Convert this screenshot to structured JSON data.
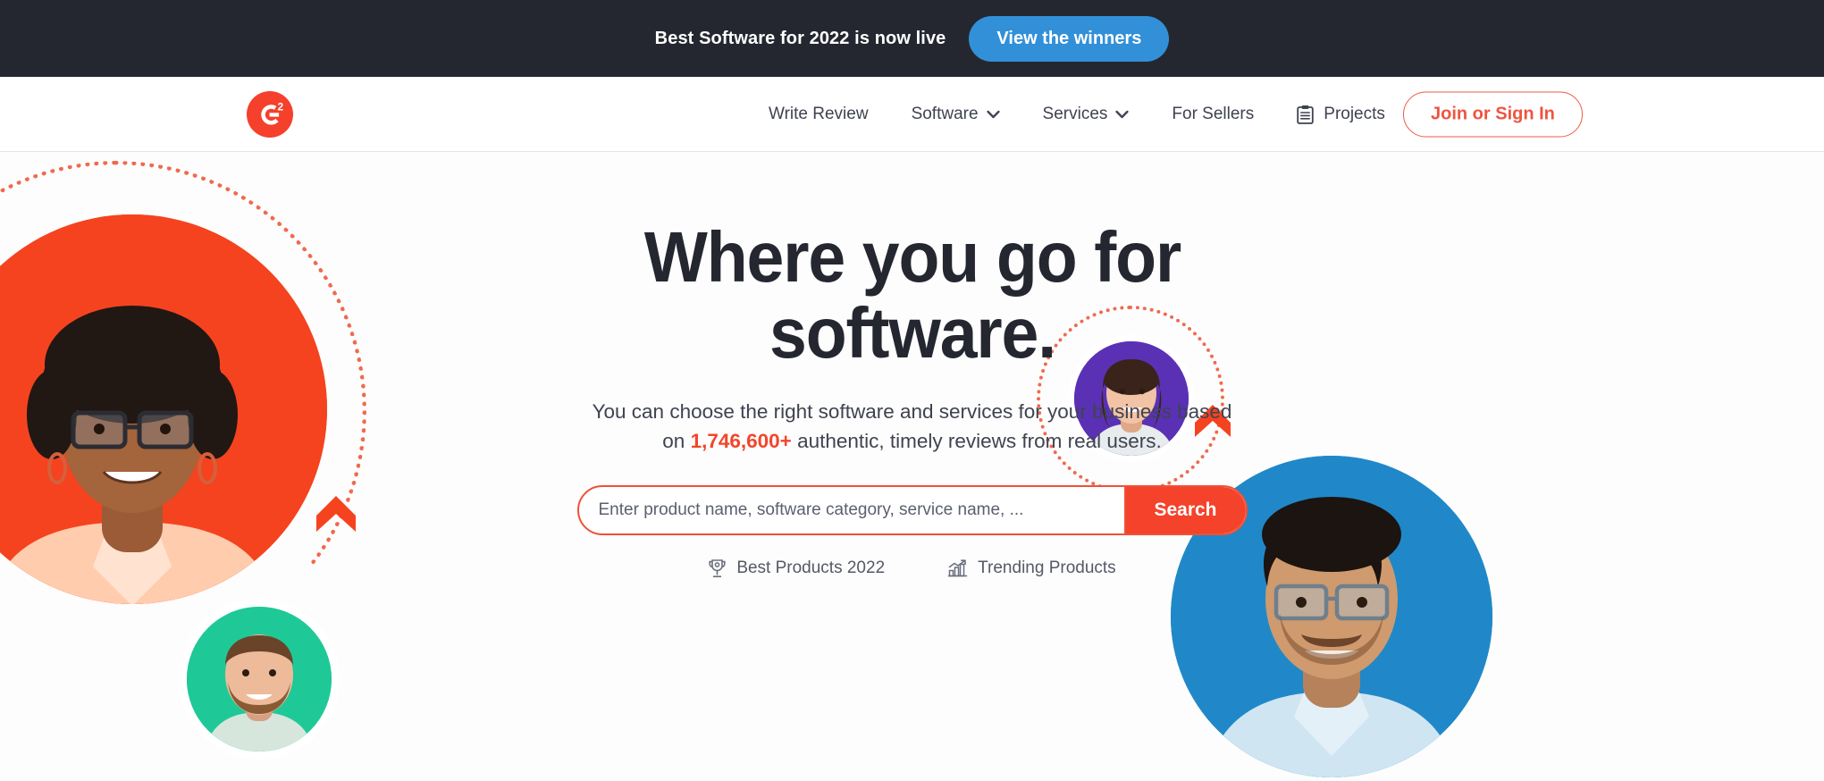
{
  "promo_banner": {
    "message": "Best Software for 2022 is now live",
    "button_label": "View the winners",
    "background_color": "#252730",
    "button_color": "#3190d8"
  },
  "navbar": {
    "logo_alt": "G2",
    "logo_mark": "G",
    "logo_superscript": "2",
    "logo_color": "#f5402c",
    "items": [
      {
        "label": "Write Review",
        "has_dropdown": false,
        "icon": null
      },
      {
        "label": "Software",
        "has_dropdown": true,
        "icon": "chevron-down-icon"
      },
      {
        "label": "Services",
        "has_dropdown": true,
        "icon": "chevron-down-icon"
      },
      {
        "label": "For Sellers",
        "has_dropdown": false,
        "icon": null
      },
      {
        "label": "Projects",
        "has_dropdown": false,
        "icon": "clipboard-icon"
      }
    ],
    "signin_label": "Join or Sign In",
    "signin_color": "#ee5440"
  },
  "hero": {
    "headline_line1": "Where you go for",
    "headline_line2": "software.",
    "headline_color": "#252730",
    "subhead_before": "You can choose the right software and services for your business based on ",
    "subhead_count": "1,746,600+",
    "subhead_after": " authentic, timely reviews from real users.",
    "count_color": "#f2452a",
    "search": {
      "placeholder": "Enter product name, software category, service name, ...",
      "value": "",
      "button_label": "Search",
      "button_color": "#f5422a",
      "border_color": "#ef5138"
    },
    "quick_links": [
      {
        "label": "Best Products 2022",
        "icon": "trophy-icon"
      },
      {
        "label": "Trending Products",
        "icon": "trending-chart-icon"
      }
    ],
    "decor": {
      "circle_red": "#f5431f",
      "circle_green": "#1fc997",
      "circle_purple": "#5a31b5",
      "circle_blue": "#2088c8",
      "dotted_ring": "#f05a3c",
      "chevron": "#f5431f"
    },
    "portraits": [
      {
        "name": "portrait-woman-glasses",
        "circle_color": "#f5431f"
      },
      {
        "name": "portrait-man-beard",
        "circle_color": "#1fc997"
      },
      {
        "name": "portrait-woman-smiling",
        "circle_color": "#5a31b5"
      },
      {
        "name": "portrait-man-glasses",
        "circle_color": "#2088c8"
      }
    ]
  }
}
